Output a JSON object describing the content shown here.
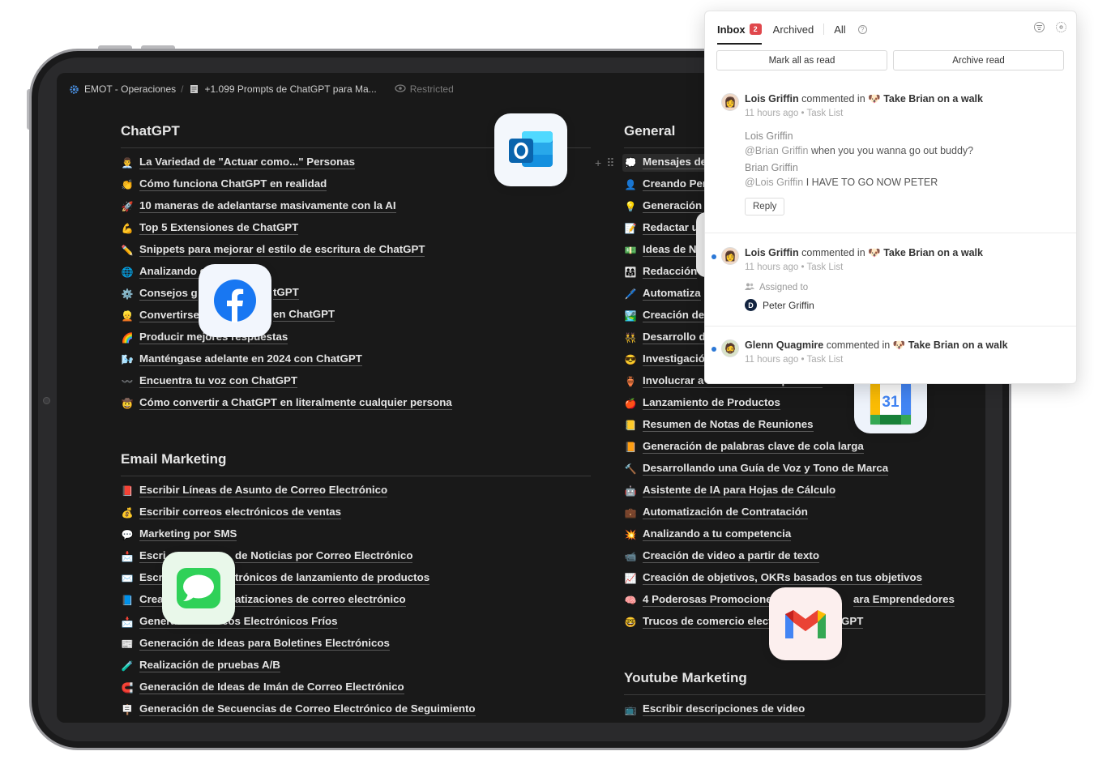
{
  "breadcrumb": {
    "workspace": "EMOT - Operaciones",
    "separator": "/",
    "page": "+1.099 Prompts de ChatGPT para Ma...",
    "restricted": "Restricted"
  },
  "sections": {
    "chatgpt": {
      "title": "ChatGPT",
      "items": [
        {
          "emoji": "👨‍💼",
          "label": "La Variedad de \"Actuar como...\" Personas"
        },
        {
          "emoji": "👏",
          "label": "Cómo funciona ChatGPT en realidad"
        },
        {
          "emoji": "🚀",
          "label": "10 maneras de adelantarse masivamente con la AI"
        },
        {
          "emoji": "💪",
          "label": "Top 5 Extensiones de ChatGPT"
        },
        {
          "emoji": "✏️",
          "label": "Snippets para mejorar el estilo de escritura de ChatGPT"
        },
        {
          "emoji": "🌐",
          "label": "Analizando e"
        },
        {
          "emoji": "⚙️",
          "label": "Consejos g"
        },
        {
          "emoji": "👱",
          "label": "Convertirse"
        },
        {
          "emoji": "🌈",
          "label": "Producir mejores respuestas"
        },
        {
          "emoji": "🌬️",
          "label": "Manténgase adelante en 2024 con ChatGPT"
        },
        {
          "emoji": "〰️",
          "label": "Encuentra tu voz con ChatGPT"
        },
        {
          "emoji": "🤠",
          "label": "Cómo convertir a ChatGPT en literalmente cualquier persona"
        }
      ],
      "partials": {
        "row6_tail": "tGPT",
        "row7_tail": "en ChatGPT"
      }
    },
    "email": {
      "title": "Email Marketing",
      "items": [
        {
          "emoji": "📕",
          "label": "Escribir Líneas de Asunto de Correo Electrónico"
        },
        {
          "emoji": "💰",
          "label": "Escribir correos electrónicos de ventas"
        },
        {
          "emoji": "💬",
          "label": "Marketing por SMS"
        },
        {
          "emoji": "📩",
          "label": "Escri"
        },
        {
          "emoji": "✉️",
          "label": "Escr"
        },
        {
          "emoji": "📘",
          "label": "Crea"
        },
        {
          "emoji": "📩",
          "label": "Generando Correos Electrónicos Fríos"
        },
        {
          "emoji": "📰",
          "label": "Generación de Ideas para Boletines Electrónicos"
        },
        {
          "emoji": "🧪",
          "label": "Realización de pruebas A/B"
        },
        {
          "emoji": "🧲",
          "label": "Generación de Ideas de Imán de Correo Electrónico"
        },
        {
          "emoji": "🪧",
          "label": "Generación de Secuencias de Correo Electrónico de Seguimiento"
        }
      ],
      "partials": {
        "row4_tail": "de Noticias por Correo Electrónico",
        "row5_tail": "trónicos de lanzamiento de productos",
        "row6_tail": "atizaciones de correo electrónico"
      }
    },
    "general": {
      "title": "General",
      "items": [
        {
          "emoji": "💭",
          "label": "Mensajes de"
        },
        {
          "emoji": "👤",
          "label": "Creando Per"
        },
        {
          "emoji": "💡",
          "label": "Generación"
        },
        {
          "emoji": "📝",
          "label": "Redactar u"
        },
        {
          "emoji": "💵",
          "label": "Ideas de N"
        },
        {
          "emoji": "👨‍👩‍👧",
          "label": "Redacción"
        },
        {
          "emoji": "🖊️",
          "label": "Automatiza"
        },
        {
          "emoji": "🏞️",
          "label": "Creación de"
        },
        {
          "emoji": "👯",
          "label": "Desarrollo d"
        },
        {
          "emoji": "😎",
          "label": "Investigació"
        },
        {
          "emoji": "🏺",
          "label": "Involucrar a los nuevos empleados"
        },
        {
          "emoji": "🍎",
          "label": "Lanzamiento de Productos"
        },
        {
          "emoji": "📒",
          "label": "Resumen de Notas de Reuniones"
        },
        {
          "emoji": "📙",
          "label": "Generación de palabras clave de cola larga"
        },
        {
          "emoji": "🔨",
          "label": "Desarrollando una Guía de Voz y Tono de Marca"
        },
        {
          "emoji": "🤖",
          "label": "Asistente de IA para Hojas de Cálculo"
        },
        {
          "emoji": "💼",
          "label": "Automatización de Contratación"
        },
        {
          "emoji": "💥",
          "label": "Analizando a tu competencia"
        },
        {
          "emoji": "📹",
          "label": "Creación de video a partir de texto"
        },
        {
          "emoji": "📈",
          "label": "Creación de objetivos, OKRs basados en tus objetivos"
        },
        {
          "emoji": "🧠",
          "label": "4 Poderosas Promociones"
        },
        {
          "emoji": "🤓",
          "label": "Trucos de comercio elect"
        }
      ],
      "partials": {
        "row21_tail": "ara Emprendedores",
        "row22_tail": "GPT"
      }
    },
    "youtube": {
      "title": "Youtube Marketing",
      "items": [
        {
          "emoji": "📺",
          "label": "Escribir descripciones de video"
        }
      ]
    }
  },
  "apps": {
    "outlook": "outlook-app-icon",
    "facebook": "facebook-app-icon",
    "messages": "messages-app-icon",
    "gmail": "gmail-app-icon",
    "calendar": "google-calendar-app-icon",
    "calendar_day": "31"
  },
  "panel": {
    "tabs": {
      "inbox": "Inbox",
      "inbox_count": "2",
      "archived": "Archived",
      "all": "All",
      "help": "?"
    },
    "actions": {
      "mark_all": "Mark all as read",
      "archive_all": "Archive read"
    },
    "notifications": [
      {
        "author": "Lois Griffin",
        "verb": "commented in",
        "task_emoji": "🐶",
        "task": "Take Brian on a walk",
        "time": "11 hours ago",
        "list": "Task List",
        "thread": [
          {
            "who": "Lois Griffin",
            "mention": "@Brian Griffin",
            "text": "when you you wanna go out buddy?"
          },
          {
            "who": "Brian Griffin",
            "mention": "@Lois Griffin",
            "text": "I HAVE TO GO NOW PETER"
          }
        ],
        "reply_label": "Reply"
      },
      {
        "author": "Lois Griffin",
        "verb": "commented in",
        "task_emoji": "🐶",
        "task": "Take Brian on a walk",
        "time": "11 hours ago",
        "list": "Task List",
        "assigned_label": "Assigned to",
        "assignee_initial": "D",
        "assignee": "Peter Griffin"
      },
      {
        "author": "Glenn Quagmire",
        "verb": "commented in",
        "task_emoji": "🐶",
        "task": "Take Brian on a walk",
        "time": "11 hours ago",
        "list": "Task List"
      }
    ],
    "meta_separator": "•"
  },
  "colors": {
    "screen_bg": "#191919",
    "text_light": "#e3e3e3",
    "badge_red": "#e0474c",
    "unread_blue": "#2b78d6"
  }
}
